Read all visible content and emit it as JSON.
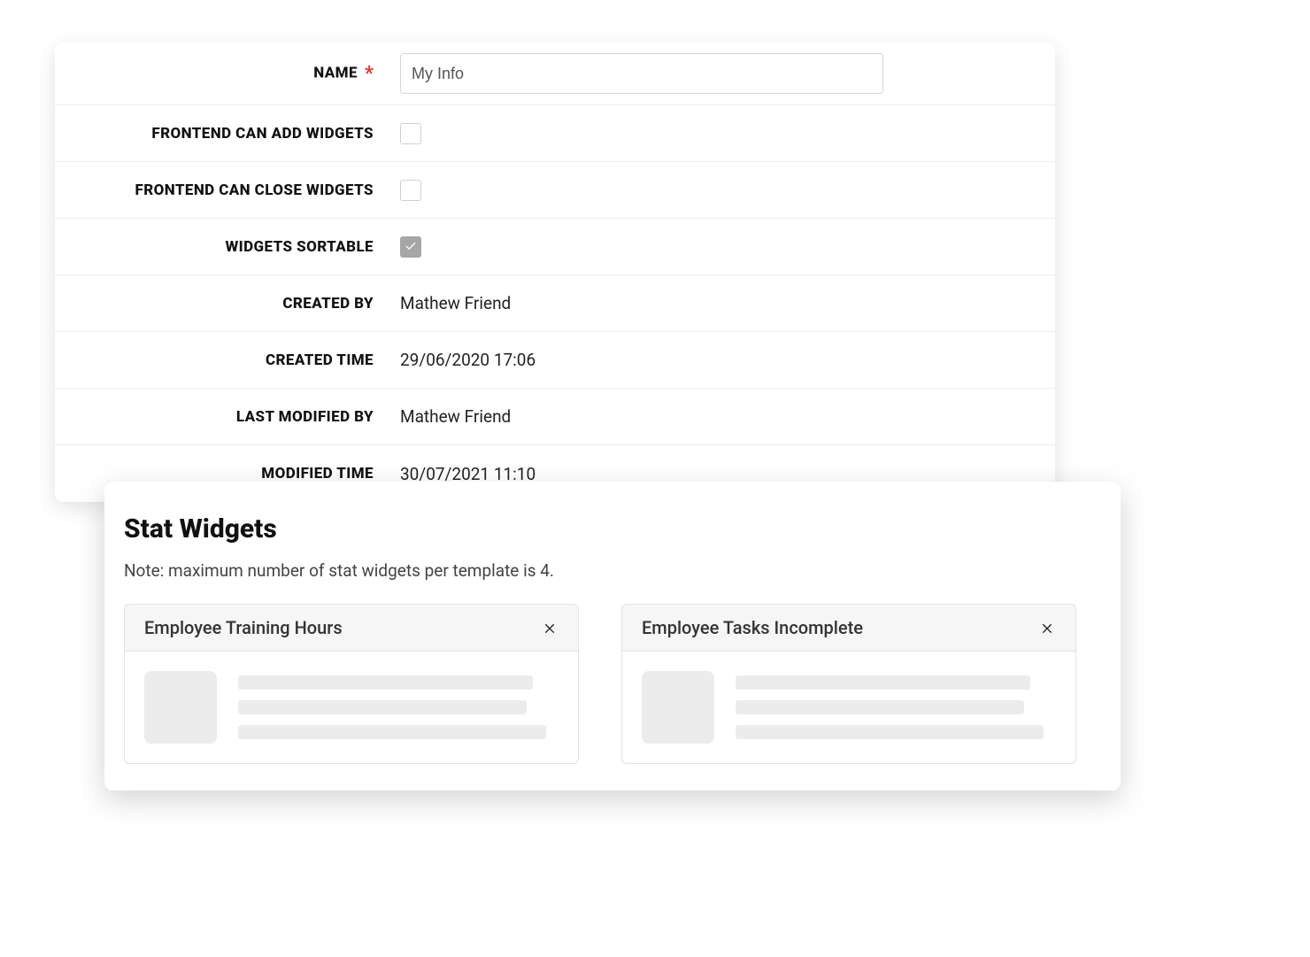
{
  "form": {
    "name_label": "NAME",
    "name_value": "My Info",
    "required_marker": "*",
    "can_add_label": "FRONTEND CAN ADD WIDGETS",
    "can_add_checked": false,
    "can_close_label": "FRONTEND CAN CLOSE WIDGETS",
    "can_close_checked": false,
    "sortable_label": "WIDGETS SORTABLE",
    "sortable_checked": true,
    "created_by_label": "CREATED BY",
    "created_by_value": "Mathew Friend",
    "created_time_label": "CREATED TIME",
    "created_time_value": "29/06/2020 17:06",
    "last_modified_by_label": "LAST MODIFIED BY",
    "last_modified_by_value": "Mathew Friend",
    "modified_time_label": "MODIFIED TIME",
    "modified_time_value": "30/07/2021 11:10"
  },
  "stat_section": {
    "title": "Stat Widgets",
    "note": "Note: maximum number of stat widgets per template is 4.",
    "cards": [
      {
        "title": "Employee Training Hours"
      },
      {
        "title": "Employee Tasks Incomplete"
      }
    ]
  }
}
